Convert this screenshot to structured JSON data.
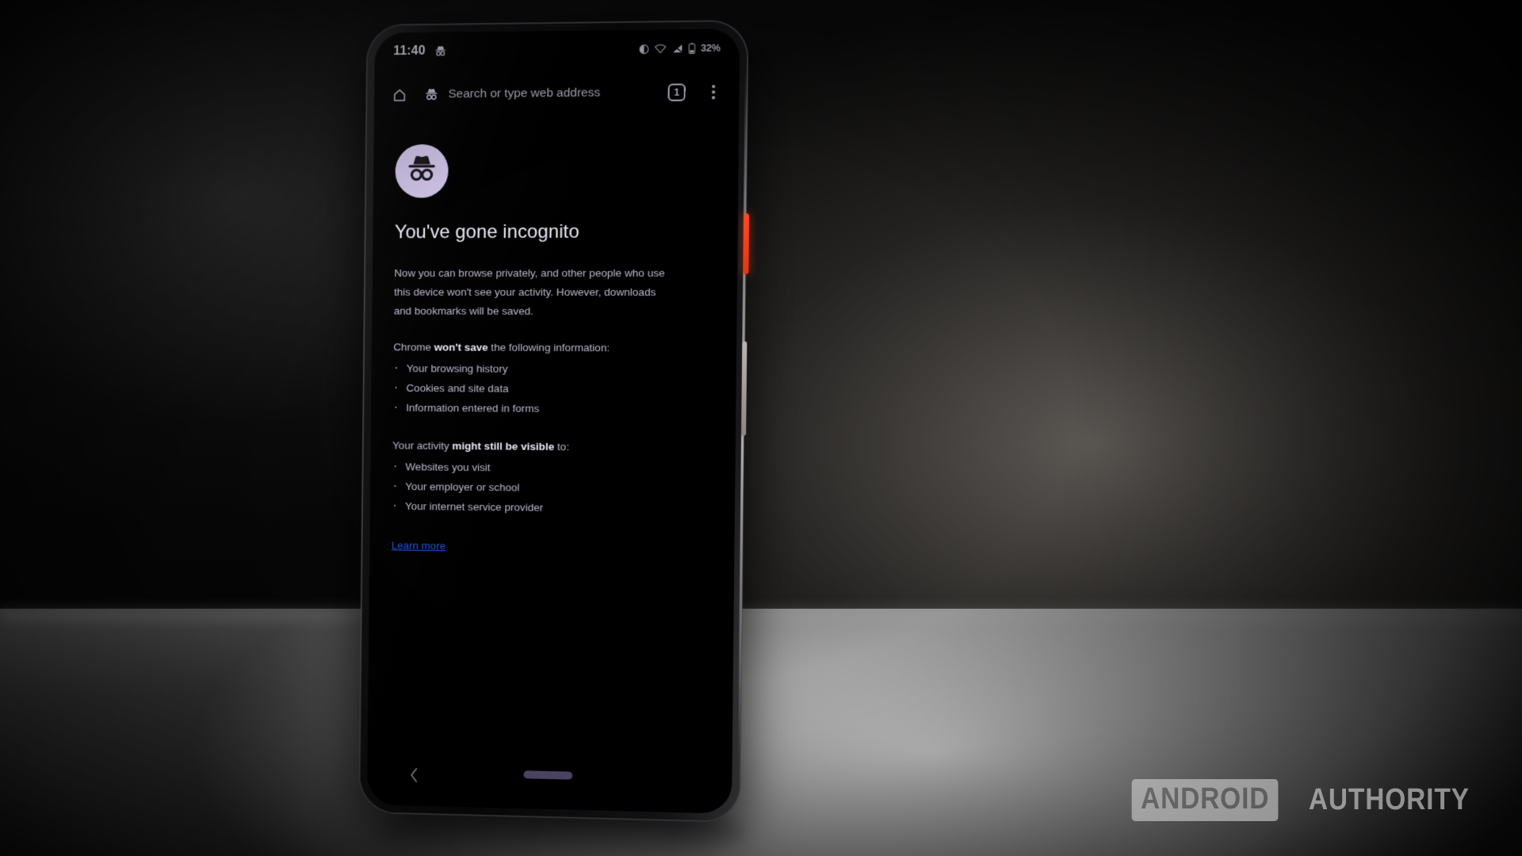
{
  "scene": {
    "description": "smartphone on a desk showing Chrome incognito new tab page",
    "background_dark": "#0a0a0a",
    "surface_light": "#d6d6d6"
  },
  "phone": {
    "buttons": [
      {
        "name": "power-button",
        "color": "#ff4a1e"
      },
      {
        "name": "volume-rocker",
        "color": "#b9b4b0"
      }
    ]
  },
  "statusbar": {
    "time": "11:40",
    "incognito_icon": "incognito-icon",
    "icons": [
      "location-icon",
      "wifi-icon",
      "signal-icon",
      "battery-icon"
    ],
    "battery_percent": "32%"
  },
  "toolbar": {
    "home_icon": "home-icon",
    "incognito_icon": "incognito-icon",
    "omnibox_placeholder": "Search or type web address",
    "tab_count": "1",
    "menu_icon": "more-vertical-icon"
  },
  "page": {
    "avatar_icon": "incognito-avatar-icon",
    "title": "You've gone incognito",
    "paragraph": "Now you can browse privately, and other people who use this device won't see your activity. However, downloads and bookmarks will be saved.",
    "section_one": {
      "lead_prefix": "Chrome ",
      "lead_bold": "won't save",
      "lead_suffix": " the following information:",
      "items": [
        "Your browsing history",
        "Cookies and site data",
        "Information entered in forms"
      ]
    },
    "section_two": {
      "lead_prefix": "Your activity ",
      "lead_bold": "might still be visible",
      "lead_suffix": " to:",
      "items": [
        "Websites you visit",
        "Your employer or school",
        "Your internet service provider"
      ]
    },
    "learn_more": "Learn more",
    "link_color": "#1a55d8"
  },
  "navbar": {
    "back_icon": "chevron-left-icon",
    "gesture_pill": "home-gesture-pill",
    "pill_color": "#6f6490"
  },
  "watermark": {
    "boxed_word": "ANDROID",
    "plain_word": "AUTHORITY"
  }
}
